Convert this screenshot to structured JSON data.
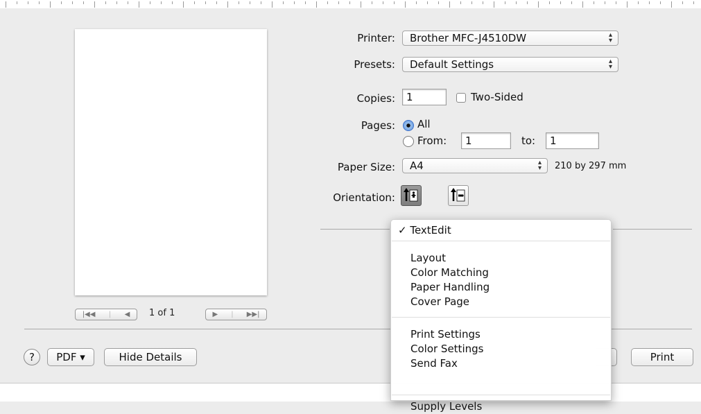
{
  "preview": {
    "page_indicator": "1 of 1",
    "nav_first": "|◀◀",
    "nav_prev": "◀",
    "nav_next": "▶",
    "nav_last": "▶▶|"
  },
  "form": {
    "printer_label": "Printer:",
    "printer_value": "Brother MFC-J4510DW",
    "presets_label": "Presets:",
    "presets_value": "Default Settings",
    "copies_label": "Copies:",
    "copies_value": "1",
    "two_sided_label": "Two-Sided",
    "pages_label": "Pages:",
    "pages_all": "All",
    "pages_from": "From:",
    "from_value": "1",
    "to_label": "to:",
    "to_value": "1",
    "paper_size_label": "Paper Size:",
    "paper_size_value": "A4",
    "paper_size_dims": "210 by 297 mm",
    "orientation_label": "Orientation:"
  },
  "menu": {
    "checked_item": "TextEdit",
    "groups": [
      [
        "Layout",
        "Color Matching",
        "Paper Handling",
        "Cover Page"
      ],
      [
        "Print Settings",
        "Color Settings",
        "Send Fax"
      ],
      [
        "Supply Levels"
      ]
    ]
  },
  "footer": {
    "help": "?",
    "pdf_label": "PDF ▾",
    "hide_details": "Hide Details",
    "print": "Print"
  }
}
